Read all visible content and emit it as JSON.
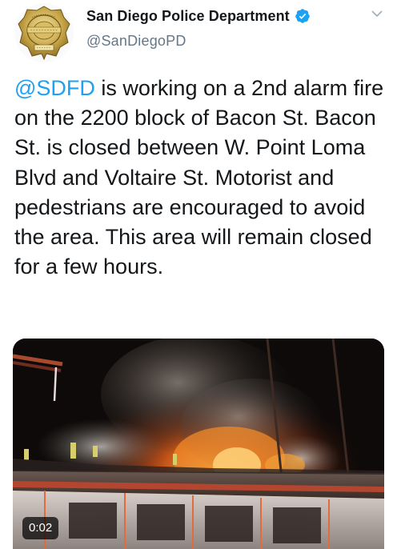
{
  "author": {
    "display_name": "San Diego Police Department",
    "handle": "@SanDiegoPD",
    "verified": true,
    "avatar": "police-badge-logo"
  },
  "tweet": {
    "mention": "@SDFD",
    "text_after_mention": " is working on a 2nd alarm fire on the 2200 block of Bacon St.  Bacon St. is closed between W. Point Loma Blvd and Voltaire St. Motorist and pedestrians are encouraged to avoid the area. This area will remain closed for a few hours."
  },
  "media": {
    "type": "video",
    "duration": "0:02",
    "subject": "building-fire-night"
  },
  "icons": {
    "verified": "verified-badge-icon",
    "menu": "chevron-down-icon"
  },
  "colors": {
    "link": "#1da1f2",
    "verified": "#1da1f2",
    "secondary_text": "#657786",
    "primary_text": "#14171a"
  }
}
